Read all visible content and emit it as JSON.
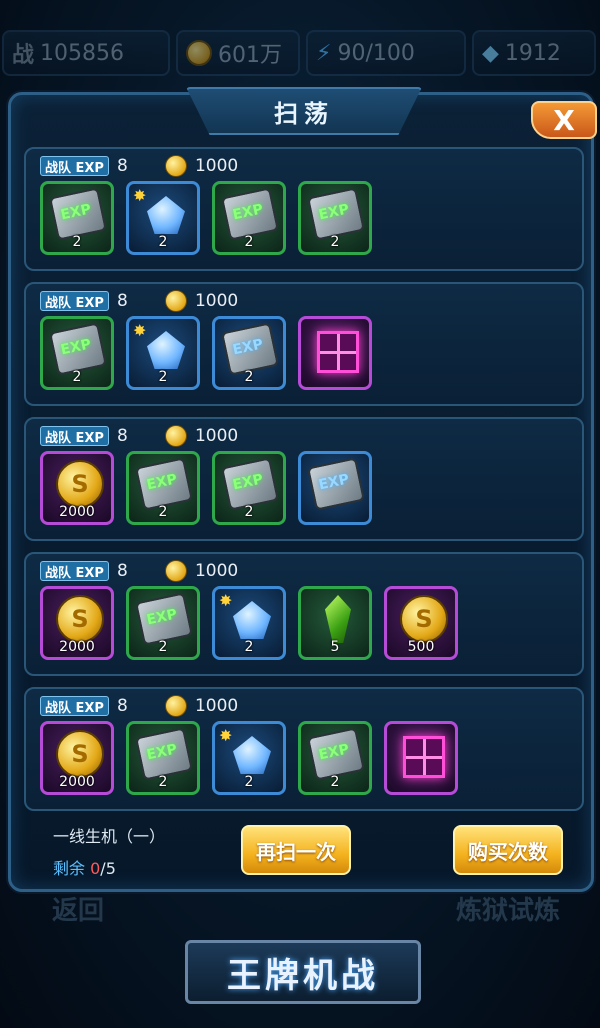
{
  "topbar": {
    "power_icon": "战",
    "power_value": "105856",
    "gold_value": "601万",
    "energy_value": "90/100",
    "diamond_value": "1912"
  },
  "dialog": {
    "title": "扫荡",
    "close_label": "X",
    "rows": [
      {
        "team_label": "战队 EXP",
        "exp": "8",
        "gold": "1000",
        "items": [
          {
            "icon": "exp-card-green",
            "qty": "2"
          },
          {
            "icon": "blue-crystal",
            "qty": "2"
          },
          {
            "icon": "exp-card-green",
            "qty": "2"
          },
          {
            "icon": "exp-card-green",
            "qty": "2"
          }
        ]
      },
      {
        "team_label": "战队 EXP",
        "exp": "8",
        "gold": "1000",
        "items": [
          {
            "icon": "exp-card-green",
            "qty": "2"
          },
          {
            "icon": "blue-crystal",
            "qty": "2"
          },
          {
            "icon": "exp-card-blue",
            "qty": "2"
          },
          {
            "icon": "mystery-box",
            "qty": ""
          }
        ]
      },
      {
        "team_label": "战队 EXP",
        "exp": "8",
        "gold": "1000",
        "items": [
          {
            "icon": "gold-coin",
            "qty": "2000"
          },
          {
            "icon": "exp-card-green",
            "qty": "2"
          },
          {
            "icon": "exp-card-green",
            "qty": "2"
          },
          {
            "icon": "exp-card-blue",
            "qty": ""
          }
        ]
      },
      {
        "team_label": "战队 EXP",
        "exp": "8",
        "gold": "1000",
        "items": [
          {
            "icon": "gold-coin",
            "qty": "2000"
          },
          {
            "icon": "exp-card-green",
            "qty": "2"
          },
          {
            "icon": "blue-crystal",
            "qty": "2"
          },
          {
            "icon": "green-shard",
            "qty": "5"
          },
          {
            "icon": "gold-coin",
            "qty": "500"
          }
        ]
      },
      {
        "team_label": "战队 EXP",
        "exp": "8",
        "gold": "1000",
        "items": [
          {
            "icon": "gold-coin",
            "qty": "2000"
          },
          {
            "icon": "exp-card-green",
            "qty": "2"
          },
          {
            "icon": "blue-crystal",
            "qty": "2"
          },
          {
            "icon": "exp-card-green",
            "qty": "2"
          },
          {
            "icon": "mystery-box",
            "qty": ""
          }
        ]
      }
    ],
    "stage_name": "一线生机（一）",
    "remain_label": "剩余",
    "remain_current": "0",
    "remain_total": "/5",
    "sweep_again_label": "再扫一次",
    "buy_times_label": "购买次数"
  },
  "background": {
    "back_label": "返回",
    "trial_label": "炼狱试炼",
    "logo_text": "王牌机战"
  }
}
